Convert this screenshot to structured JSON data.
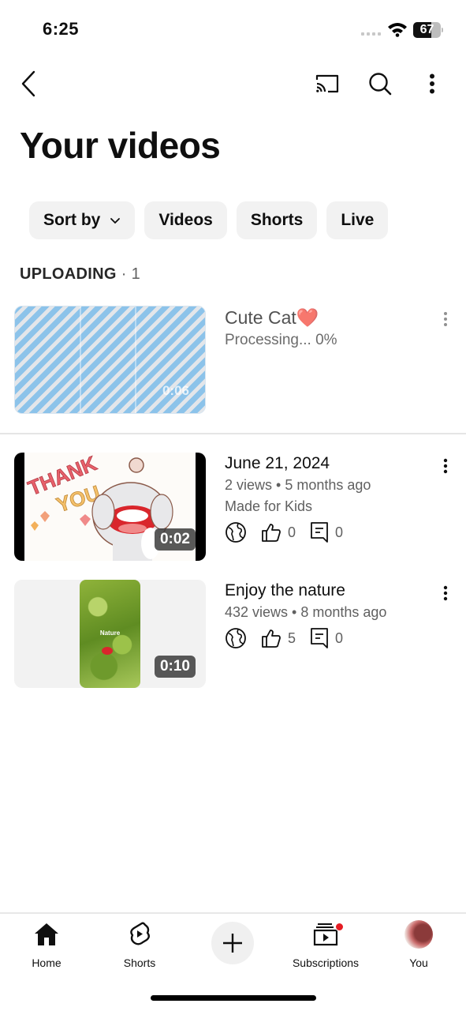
{
  "status_bar": {
    "time": "6:25",
    "battery_percent": 67,
    "battery_label": "67"
  },
  "header": {
    "title": "Your videos"
  },
  "icons": {
    "back": "chevron-left-icon",
    "cast": "cast-icon",
    "search": "search-icon",
    "more": "more-vertical-icon"
  },
  "filters": {
    "sort_label": "Sort by",
    "chips": [
      "Videos",
      "Shorts",
      "Live"
    ]
  },
  "uploading": {
    "label": "UPLOADING",
    "separator": "·",
    "count": "1",
    "item": {
      "title": "Cute Cat❤️",
      "status": "Processing... 0%",
      "progress_percent": 0,
      "duration": "0:06"
    }
  },
  "videos": [
    {
      "title": "June 21, 2024",
      "meta": "2 views • 5 months ago",
      "audience": "Made for Kids",
      "duration": "0:02",
      "visibility": "public",
      "likes": "0",
      "comments": "0",
      "thumb_text": "THANK YOU"
    },
    {
      "title": "Enjoy the nature",
      "meta": "432 views • 8 months ago",
      "duration": "0:10",
      "visibility": "public",
      "likes": "5",
      "comments": "0",
      "thumb_text": "Nature"
    }
  ],
  "bottom_nav": {
    "home": "Home",
    "shorts": "Shorts",
    "subscriptions": "Subscriptions",
    "you": "You"
  },
  "colors": {
    "accent_red": "#e51c23",
    "chip_bg": "#f2f2f2",
    "meta_gray": "#606060"
  }
}
